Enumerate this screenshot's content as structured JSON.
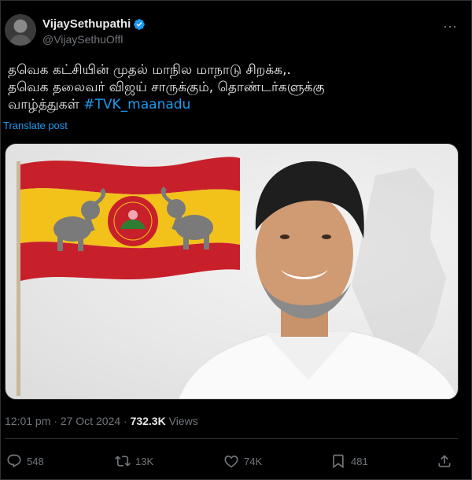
{
  "author": {
    "name": "VijaySethupathi",
    "handle": "@VijaySethuOffl"
  },
  "post": {
    "line1": "தவெக கட்சியின் முதல் மாநில மாநாடு சிறக்க,.",
    "line2": "தவெக தலைவர் விஜய் சாருக்கும், தொண்டர்களுக்கு",
    "line3_prefix": " வாழ்த்துகள் ",
    "hashtag": "#TVK_maanadu",
    "translate_label": "Translate post"
  },
  "meta": {
    "time": "12:01 pm",
    "separator": " · ",
    "date": "27 Oct 2024",
    "views_count": "732.3K",
    "views_label": " Views"
  },
  "actions": {
    "replies": "548",
    "reposts": "13K",
    "likes": "74K",
    "bookmarks": "481"
  },
  "colors": {
    "accent": "#1d9bf0",
    "flag_red": "#c8202a",
    "flag_yellow": "#f2c21b"
  },
  "icons": [
    "verified-badge-icon",
    "more-icon",
    "reply-icon",
    "repost-icon",
    "like-icon",
    "bookmark-icon",
    "share-icon"
  ]
}
